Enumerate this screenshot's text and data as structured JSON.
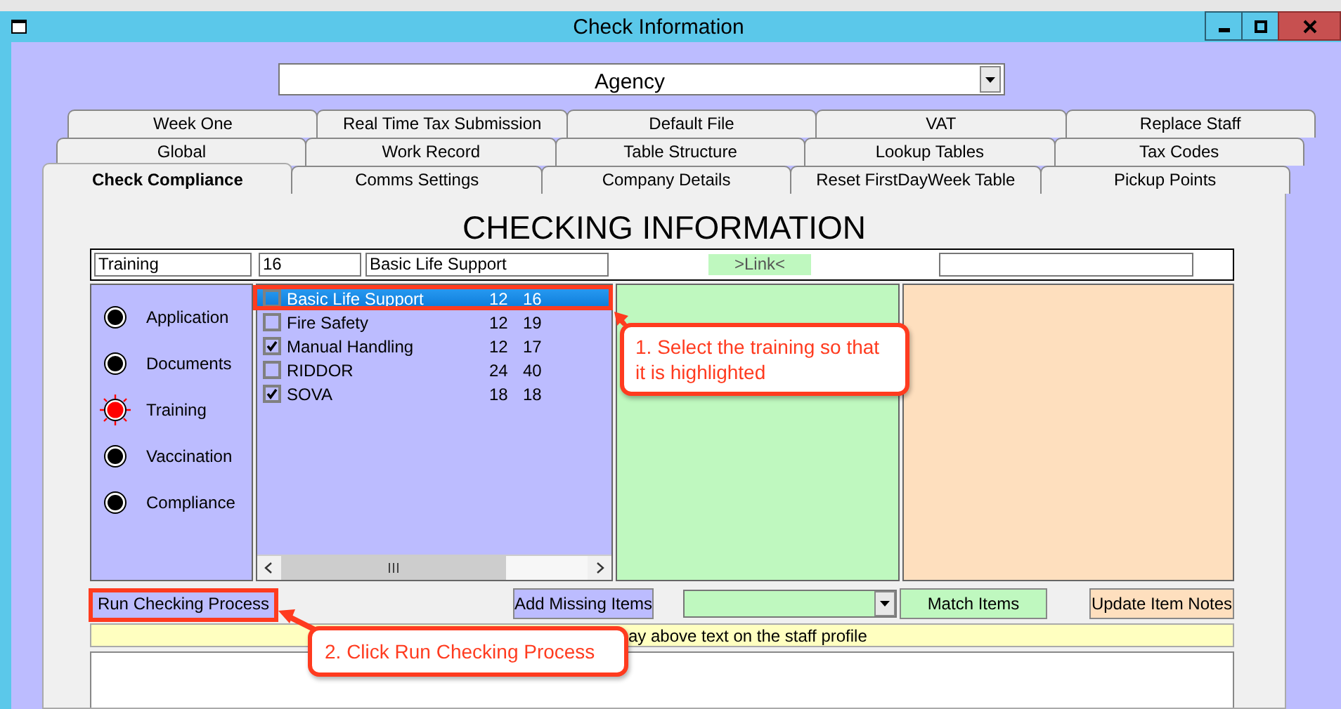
{
  "window": {
    "title": "Check Information"
  },
  "agency_dropdown": {
    "value": "Agency"
  },
  "tab_rows": [
    [
      {
        "label": "Week One",
        "selected": false
      },
      {
        "label": "Real Time Tax Submission",
        "selected": false
      },
      {
        "label": "Default File",
        "selected": false
      },
      {
        "label": "VAT",
        "selected": false
      },
      {
        "label": "Replace Staff",
        "selected": false
      }
    ],
    [
      {
        "label": "Global",
        "selected": false
      },
      {
        "label": "Work Record",
        "selected": false
      },
      {
        "label": "Table Structure",
        "selected": false
      },
      {
        "label": "Lookup Tables",
        "selected": false
      },
      {
        "label": "Tax Codes",
        "selected": false
      }
    ],
    [
      {
        "label": "Check Compliance",
        "selected": true
      },
      {
        "label": "Comms Settings",
        "selected": false
      },
      {
        "label": "Company Details",
        "selected": false
      },
      {
        "label": "Reset FirstDayWeek Table",
        "selected": false
      },
      {
        "label": "Pickup Points",
        "selected": false
      }
    ]
  ],
  "heading": "CHECKING INFORMATION",
  "info_bar": {
    "category": "Training",
    "number": "16",
    "item": "Basic Life Support",
    "link": ">Link<"
  },
  "status_items": [
    {
      "label": "Application",
      "selected": false
    },
    {
      "label": "Documents",
      "selected": false
    },
    {
      "label": "Training",
      "selected": true
    },
    {
      "label": "Vaccination",
      "selected": false
    },
    {
      "label": "Compliance",
      "selected": false
    }
  ],
  "training_list": [
    {
      "name": "Basic Life Support",
      "col_2": "12",
      "col_3": "16",
      "checked": false,
      "selected": true
    },
    {
      "name": "Fire Safety",
      "col_2": "12",
      "col_3": "19",
      "checked": false,
      "selected": false
    },
    {
      "name": "Manual Handling",
      "col_2": "12",
      "col_3": "17",
      "checked": true,
      "selected": false
    },
    {
      "name": "RIDDOR",
      "col_2": "24",
      "col_3": "40",
      "checked": false,
      "selected": false
    },
    {
      "name": "SOVA",
      "col_2": "18",
      "col_3": "18",
      "checked": true,
      "selected": false
    }
  ],
  "buttons": {
    "run": "Run Checking Process",
    "add_missing": "Add Missing Items",
    "match": "Match Items",
    "update_notes": "Update Item Notes"
  },
  "note_bar": {
    "text": "ay above text on the staff profile"
  },
  "annotations": [
    {
      "text": "1. Select the training so that it is highlighted"
    },
    {
      "text": "2. Click Run Checking Process"
    }
  ]
}
